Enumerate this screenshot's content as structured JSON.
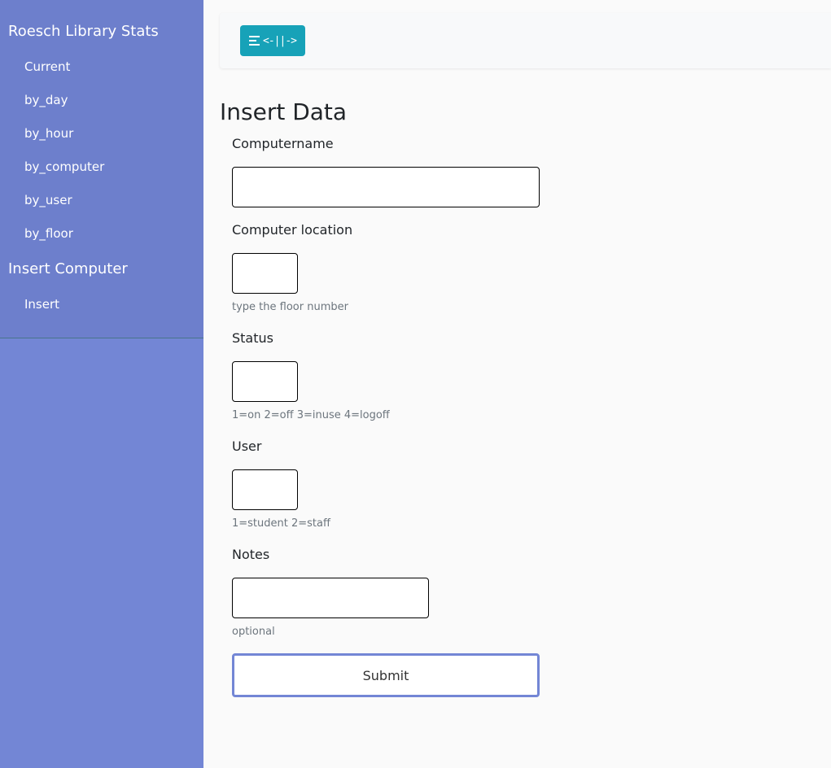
{
  "sidebar": {
    "section1_title": "Roesch Library Stats",
    "section1_items": [
      "Current",
      "by_day",
      "by_hour",
      "by_computer",
      "by_user",
      "by_floor"
    ],
    "section2_title": "Insert Computer",
    "section2_items": [
      "Insert"
    ]
  },
  "topbar": {
    "toggle_label": "<-||->",
    "toggle_icon": "bars-icon",
    "toggle_color": "#17a2b8"
  },
  "page": {
    "title": "Insert Data"
  },
  "form": {
    "computername_label": "Computername",
    "location_label": "Computer location",
    "location_hint": "type the floor number",
    "status_label": "Status",
    "status_hint": "1=on 2=off 3=inuse 4=logoff",
    "user_label": "User",
    "user_hint": "1=student 2=staff",
    "notes_label": "Notes",
    "notes_hint": "optional",
    "submit_label": "Submit"
  },
  "colors": {
    "sidebar": "#7386d5",
    "sidebar_panel": "#6d7fcc",
    "submit_border": "#7386d5"
  }
}
